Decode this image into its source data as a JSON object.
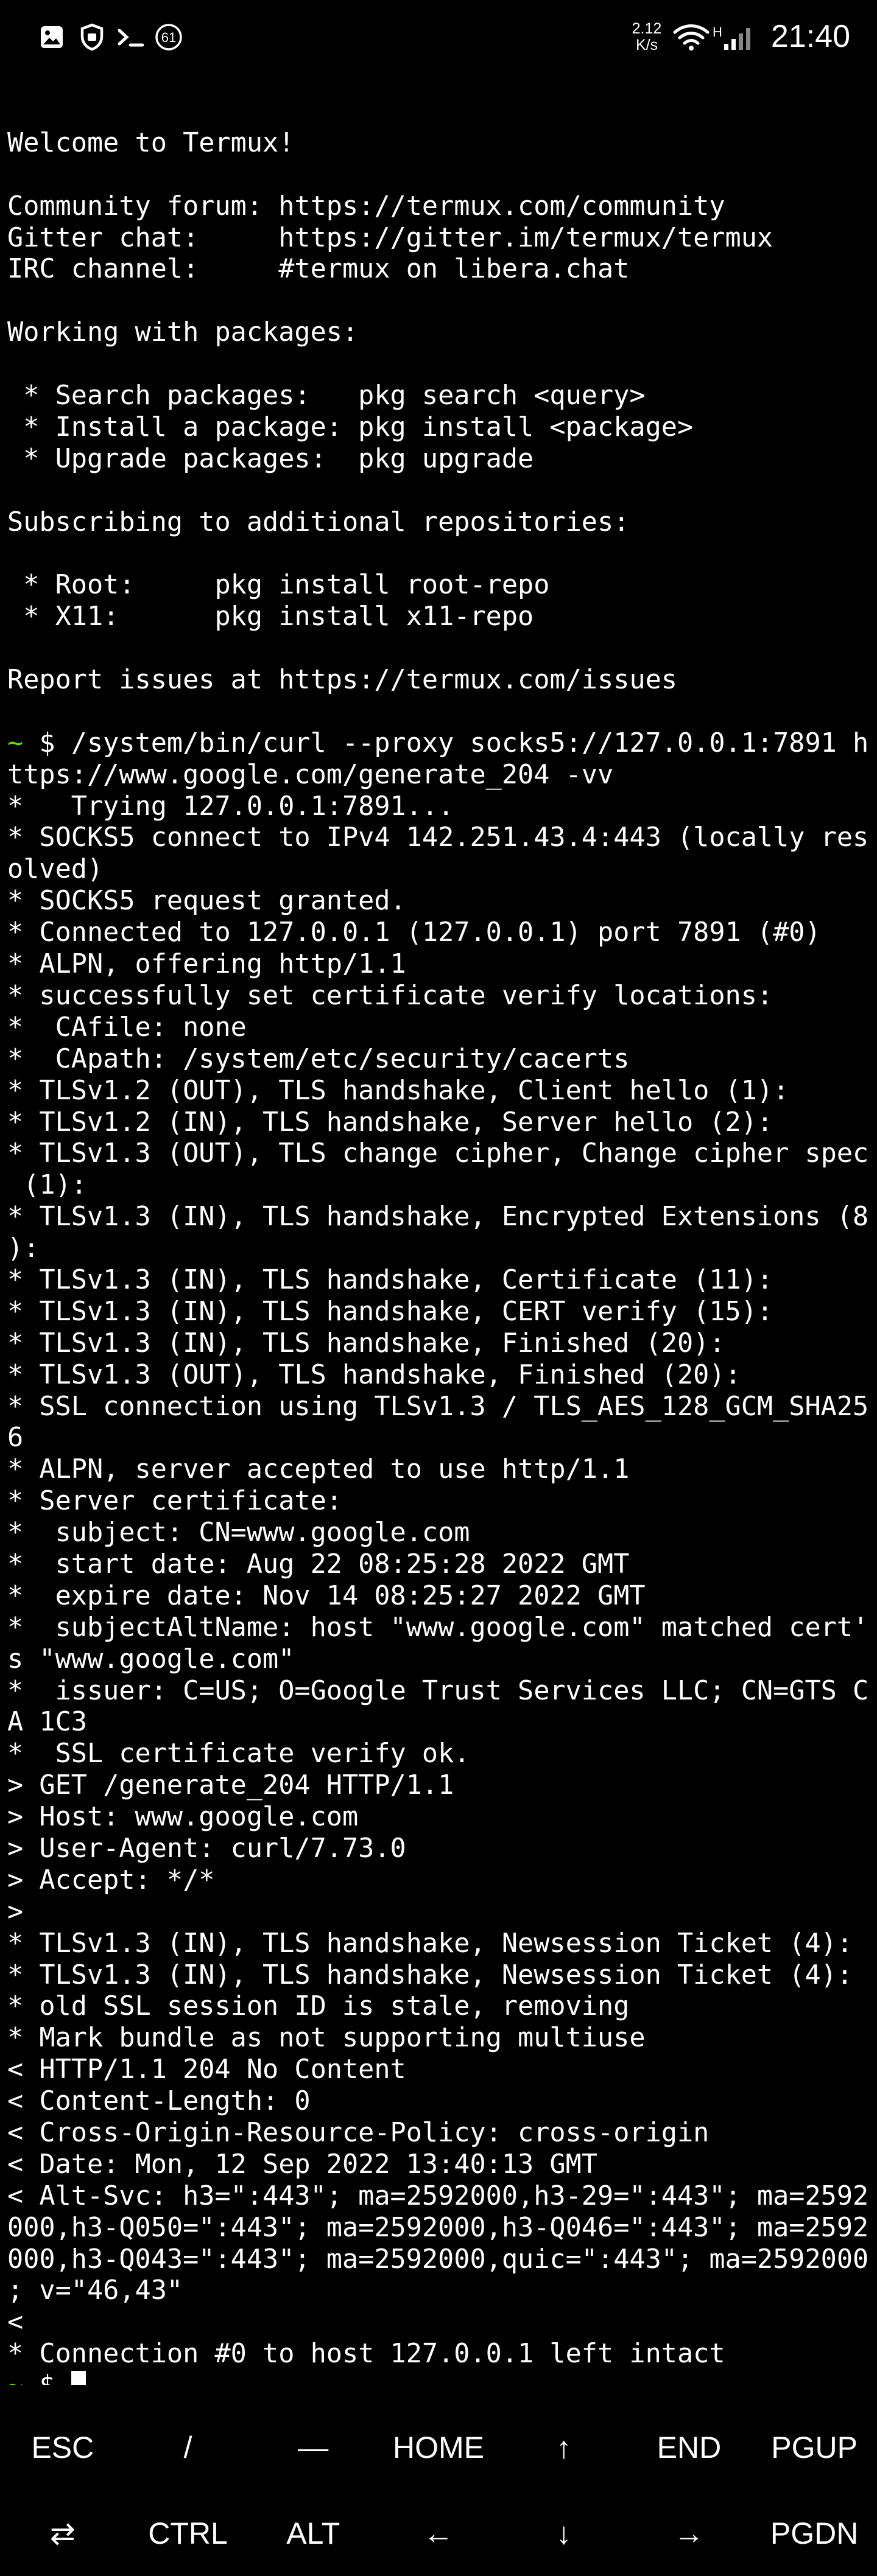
{
  "status_bar": {
    "notification_count": "61",
    "net_speed_value": "2.12",
    "net_speed_unit": "K/s",
    "network_type": "H",
    "time": "21:40"
  },
  "terminal": {
    "lines": [
      "",
      "Welcome to Termux!",
      "",
      "Community forum: https://termux.com/community",
      "Gitter chat:     https://gitter.im/termux/termux",
      "IRC channel:     #termux on libera.chat",
      "",
      "Working with packages:",
      "",
      " * Search packages:   pkg search <query>",
      " * Install a package: pkg install <package>",
      " * Upgrade packages:  pkg upgrade",
      "",
      "Subscribing to additional repositories:",
      "",
      " * Root:     pkg install root-repo",
      " * X11:      pkg install x11-repo",
      "",
      "Report issues at https://termux.com/issues",
      "",
      "~ $ /system/bin/curl --proxy socks5://127.0.0.1:7891 h",
      "ttps://www.google.com/generate_204 -vv",
      "*   Trying 127.0.0.1:7891...",
      "* SOCKS5 connect to IPv4 142.251.43.4:443 (locally res",
      "olved)",
      "* SOCKS5 request granted.",
      "* Connected to 127.0.0.1 (127.0.0.1) port 7891 (#0)",
      "* ALPN, offering http/1.1",
      "* successfully set certificate verify locations:",
      "*  CAfile: none",
      "*  CApath: /system/etc/security/cacerts",
      "* TLSv1.2 (OUT), TLS handshake, Client hello (1):",
      "* TLSv1.2 (IN), TLS handshake, Server hello (2):",
      "* TLSv1.3 (OUT), TLS change cipher, Change cipher spec",
      " (1):",
      "* TLSv1.3 (IN), TLS handshake, Encrypted Extensions (8",
      "):",
      "* TLSv1.3 (IN), TLS handshake, Certificate (11):",
      "* TLSv1.3 (IN), TLS handshake, CERT verify (15):",
      "* TLSv1.3 (IN), TLS handshake, Finished (20):",
      "* TLSv1.3 (OUT), TLS handshake, Finished (20):",
      "* SSL connection using TLSv1.3 / TLS_AES_128_GCM_SHA25",
      "6",
      "* ALPN, server accepted to use http/1.1",
      "* Server certificate:",
      "*  subject: CN=www.google.com",
      "*  start date: Aug 22 08:25:28 2022 GMT",
      "*  expire date: Nov 14 08:25:27 2022 GMT",
      "*  subjectAltName: host \"www.google.com\" matched cert'",
      "s \"www.google.com\"",
      "*  issuer: C=US; O=Google Trust Services LLC; CN=GTS C",
      "A 1C3",
      "*  SSL certificate verify ok.",
      "> GET /generate_204 HTTP/1.1",
      "> Host: www.google.com",
      "> User-Agent: curl/7.73.0",
      "> Accept: */*",
      ">",
      "* TLSv1.3 (IN), TLS handshake, Newsession Ticket (4):",
      "* TLSv1.3 (IN), TLS handshake, Newsession Ticket (4):",
      "* old SSL session ID is stale, removing",
      "* Mark bundle as not supporting multiuse",
      "< HTTP/1.1 204 No Content",
      "< Content-Length: 0",
      "< Cross-Origin-Resource-Policy: cross-origin",
      "< Date: Mon, 12 Sep 2022 13:40:13 GMT",
      "< Alt-Svc: h3=\":443\"; ma=2592000,h3-29=\":443\"; ma=2592",
      "000,h3-Q050=\":443\"; ma=2592000,h3-Q046=\":443\"; ma=2592",
      "000,h3-Q043=\":443\"; ma=2592000,quic=\":443\"; ma=2592000",
      "; v=\"46,43\"",
      "<",
      "* Connection #0 to host 127.0.0.1 left intact"
    ],
    "prompt_tilde": "~",
    "prompt_dollar": " $ "
  },
  "extra_keys": {
    "row1": [
      "ESC",
      "/",
      "—",
      "HOME",
      "↑",
      "END",
      "PGUP"
    ],
    "row2": [
      "⇄",
      "CTRL",
      "ALT",
      "←",
      "↓",
      "→",
      "PGDN"
    ]
  },
  "colors": {
    "background": "#000000",
    "foreground": "#ffffff",
    "prompt_accent": "#5fd700"
  },
  "icons": [
    "gallery-icon",
    "shield-icon",
    "terminal-icon",
    "notification-count-icon",
    "wifi-icon",
    "signal-icon"
  ]
}
